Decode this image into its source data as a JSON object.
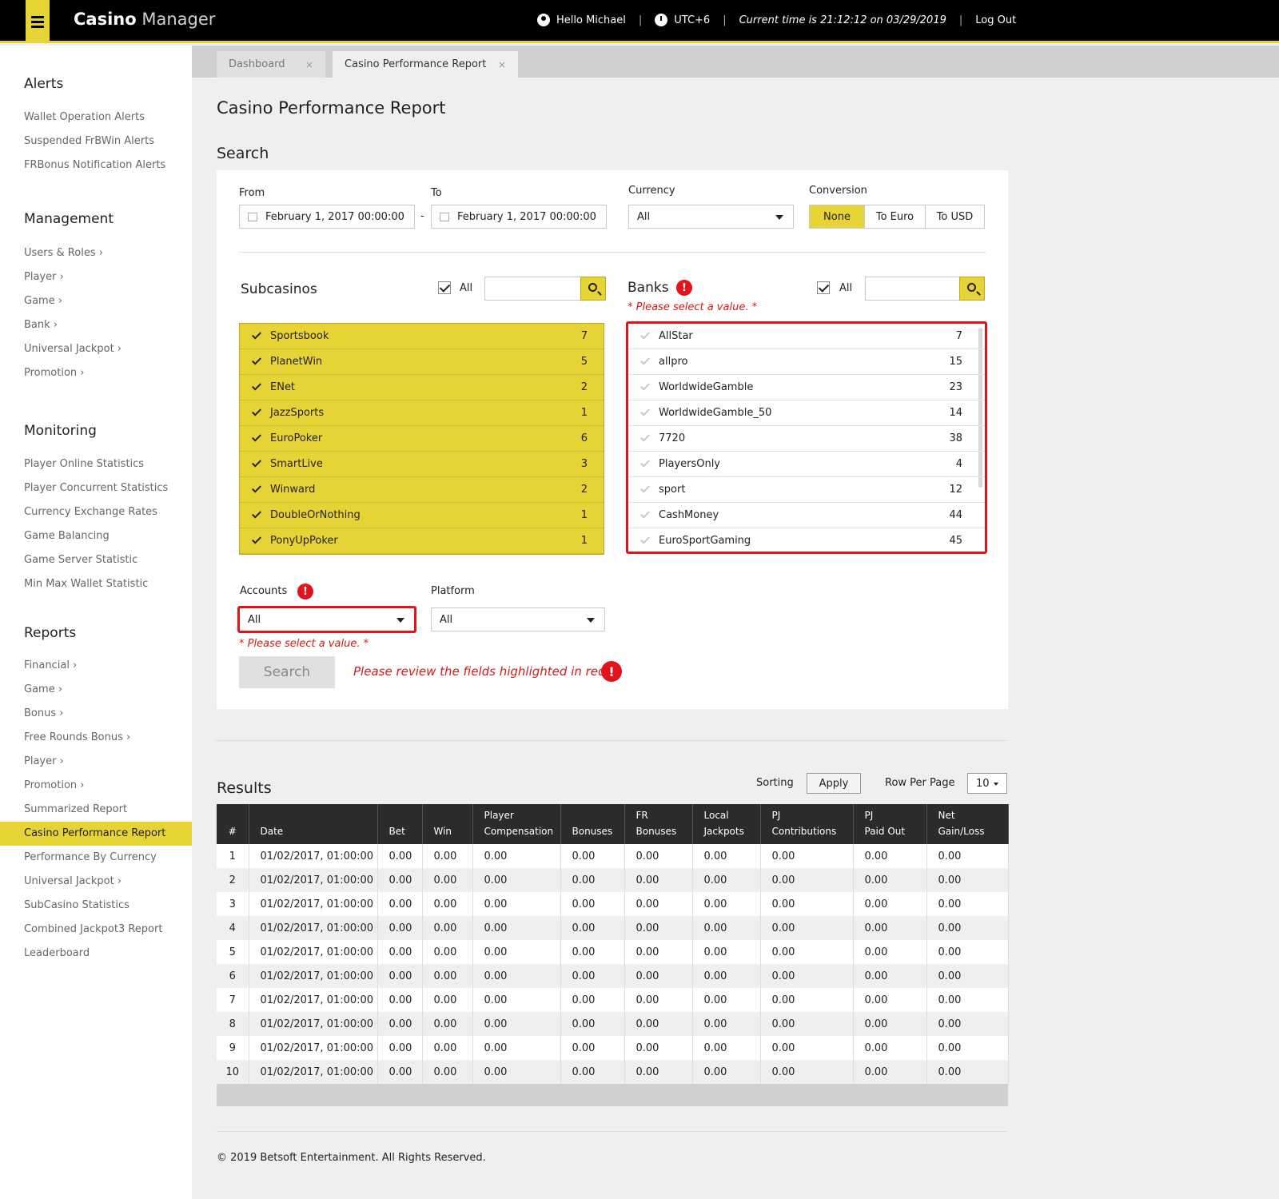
{
  "app": {
    "name_bold": "Casino",
    "name_light": "Manager"
  },
  "topbar": {
    "greeting": "Hello Michael",
    "timezone": "UTC+6",
    "current_time": "Current time is 21:12:12 on 03/29/2019",
    "logout": "Log Out",
    "separator": "|"
  },
  "sidebar": {
    "alerts_heading": "Alerts",
    "alerts": [
      "Wallet Operation Alerts",
      "Suspended FrBWin Alerts",
      "FRBonus Notification Alerts"
    ],
    "management_heading": "Management",
    "management": [
      "Users & Roles ›",
      "Player ›",
      "Game ›",
      "Bank ›",
      "Universal Jackpot ›",
      "Promotion ›"
    ],
    "monitoring_heading": "Monitoring",
    "monitoring": [
      "Player Online Statistics",
      "Player Concurrent Statistics",
      "Currency Exchange Rates",
      "Game Balancing",
      "Game Server Statistic",
      "Min Max Wallet Statistic"
    ],
    "reports_heading": "Reports",
    "reports": [
      "Financial ›",
      "Game ›",
      "Bonus ›",
      "Free Rounds Bonus ›",
      "Player ›",
      "Promotion ›",
      "Summarized Report",
      "Casino Performance Report",
      "Performance By Currency",
      "Universal Jackpot ›",
      "SubCasino Statistics",
      "Combined Jackpot3 Report",
      "Leaderboard"
    ],
    "active_item": "Casino Performance Report"
  },
  "tabs": [
    {
      "label": "Dashboard",
      "close": "×"
    },
    {
      "label": "Casino Performance Report",
      "close": "×"
    }
  ],
  "page": {
    "title": "Casino Performance Report",
    "search_heading": "Search",
    "results_heading": "Results"
  },
  "search": {
    "from_label": "From",
    "from_value": "February 1, 2017 00:00:00",
    "dash": "-",
    "to_label": "To",
    "to_value": "February 1, 2017 00:00:00",
    "currency_label": "Currency",
    "currency_value": "All",
    "conversion_label": "Conversion",
    "conversion_options": [
      "None",
      "To Euro",
      "To USD"
    ],
    "conversion_selected": "None",
    "subcasinos_label": "Subcasinos",
    "all_label": "All",
    "subcasinos": [
      {
        "name": "Sportsbook",
        "count": "7"
      },
      {
        "name": "PlanetWin",
        "count": "5"
      },
      {
        "name": "ENet",
        "count": "2"
      },
      {
        "name": "JazzSports",
        "count": "1"
      },
      {
        "name": "EuroPoker",
        "count": "6"
      },
      {
        "name": "SmartLive",
        "count": "3"
      },
      {
        "name": "Winward",
        "count": "2"
      },
      {
        "name": "DoubleOrNothing",
        "count": "1"
      },
      {
        "name": "PonyUpPoker",
        "count": "1"
      }
    ],
    "banks_label": "Banks",
    "banks_error": "* Please select a value. *",
    "banks": [
      {
        "name": "AllStar",
        "count": "7"
      },
      {
        "name": "allpro",
        "count": "15"
      },
      {
        "name": "WorldwideGamble",
        "count": "23"
      },
      {
        "name": "WorldwideGamble_50",
        "count": "14"
      },
      {
        "name": "7720",
        "count": "38"
      },
      {
        "name": "PlayersOnly",
        "count": "4"
      },
      {
        "name": "sport",
        "count": "12"
      },
      {
        "name": "CashMoney",
        "count": "44"
      },
      {
        "name": "EuroSportGaming",
        "count": "45"
      }
    ],
    "accounts_label": "Accounts",
    "accounts_value": "All",
    "accounts_error": "* Please select a value. *",
    "platform_label": "Platform",
    "platform_value": "All",
    "search_button": "Search",
    "form_error": "Please review the fields highlighted in red.",
    "error_mark": "!"
  },
  "results": {
    "sorting_label": "Sorting",
    "apply_button": "Apply",
    "rows_per_page_label": "Row Per Page",
    "rows_per_page_value": "10",
    "columns": [
      "#",
      "Date",
      "Bet",
      "Win",
      "Player\nCompensation",
      "Bonuses",
      "FR\nBonuses",
      "Local\nJackpots",
      "PJ\nContributions",
      "PJ\nPaid Out",
      "Net\nGain/Loss"
    ],
    "rows": [
      [
        "1",
        "01/02/2017, 01:00:00",
        "0.00",
        "0.00",
        "0.00",
        "0.00",
        "0.00",
        "0.00",
        "0.00",
        "0.00",
        "0.00"
      ],
      [
        "2",
        "01/02/2017, 01:00:00",
        "0.00",
        "0.00",
        "0.00",
        "0.00",
        "0.00",
        "0.00",
        "0.00",
        "0.00",
        "0.00"
      ],
      [
        "3",
        "01/02/2017, 01:00:00",
        "0.00",
        "0.00",
        "0.00",
        "0.00",
        "0.00",
        "0.00",
        "0.00",
        "0.00",
        "0.00"
      ],
      [
        "4",
        "01/02/2017, 01:00:00",
        "0.00",
        "0.00",
        "0.00",
        "0.00",
        "0.00",
        "0.00",
        "0.00",
        "0.00",
        "0.00"
      ],
      [
        "5",
        "01/02/2017, 01:00:00",
        "0.00",
        "0.00",
        "0.00",
        "0.00",
        "0.00",
        "0.00",
        "0.00",
        "0.00",
        "0.00"
      ],
      [
        "6",
        "01/02/2017, 01:00:00",
        "0.00",
        "0.00",
        "0.00",
        "0.00",
        "0.00",
        "0.00",
        "0.00",
        "0.00",
        "0.00"
      ],
      [
        "7",
        "01/02/2017, 01:00:00",
        "0.00",
        "0.00",
        "0.00",
        "0.00",
        "0.00",
        "0.00",
        "0.00",
        "0.00",
        "0.00"
      ],
      [
        "8",
        "01/02/2017, 01:00:00",
        "0.00",
        "0.00",
        "0.00",
        "0.00",
        "0.00",
        "0.00",
        "0.00",
        "0.00",
        "0.00"
      ],
      [
        "9",
        "01/02/2017, 01:00:00",
        "0.00",
        "0.00",
        "0.00",
        "0.00",
        "0.00",
        "0.00",
        "0.00",
        "0.00",
        "0.00"
      ],
      [
        "10",
        "01/02/2017, 01:00:00",
        "0.00",
        "0.00",
        "0.00",
        "0.00",
        "0.00",
        "0.00",
        "0.00",
        "0.00",
        "0.00"
      ]
    ]
  },
  "footer": {
    "copyright": "© 2019 Betsoft Entertainment. All Rights Reserved."
  },
  "colors": {
    "accent": "#e6d336",
    "error": "#e1141b",
    "header_bg": "#000000",
    "table_header_bg": "#2b2b2b"
  },
  "icons": {
    "menu": "hamburger-icon",
    "user": "user-icon",
    "clock": "clock-icon",
    "search": "search-icon",
    "calendar": "calendar-icon",
    "error": "error-icon",
    "check": "check-icon"
  }
}
